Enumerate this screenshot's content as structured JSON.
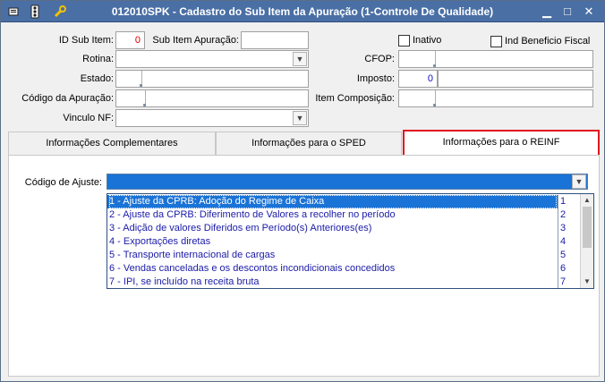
{
  "window": {
    "title": "012010SPK - Cadastro do Sub Item da Apuração (1-Controle De Qualidade)",
    "min_glyph": "▁",
    "max_glyph": "□",
    "close_glyph": "✕"
  },
  "form": {
    "id_sub_item": {
      "label": "ID Sub Item:",
      "value": "0"
    },
    "sub_item_apuracao": {
      "label": "Sub Item Apuração:",
      "value": ""
    },
    "inativo": {
      "label": "Inativo",
      "checked": false
    },
    "ind_beneficio_fiscal": {
      "label": "Ind Beneficio Fiscal",
      "checked": false
    },
    "rotina": {
      "label": "Rotina:",
      "value": ""
    },
    "cfop": {
      "label": "CFOP:",
      "value": ""
    },
    "estado": {
      "label": "Estado:",
      "value": ""
    },
    "imposto": {
      "label": "Imposto:",
      "value": "0"
    },
    "codigo_apuracao": {
      "label": "Código da Apuração:",
      "value": ""
    },
    "item_composicao": {
      "label": "Item Composição:",
      "value": ""
    },
    "vinculo_nf": {
      "label": "Vinculo NF:",
      "value": ""
    }
  },
  "tabs": [
    {
      "label": "Informações Complementares",
      "active": false
    },
    {
      "label": "Informações para o SPED",
      "active": false
    },
    {
      "label": "Informações para o REINF",
      "active": true
    }
  ],
  "reinf": {
    "codigo_ajuste_label": "Código de Ajuste:",
    "codigo_ajuste_value": "",
    "options": [
      {
        "text": "1 - Ajuste da CPRB: Adoção do Regime de Caixa",
        "code": "1",
        "selected": true
      },
      {
        "text": "2 - Ajuste da CPRB: Diferimento de Valores a recolher no período",
        "code": "2",
        "selected": false
      },
      {
        "text": "3 - Adição de valores Diferidos em Período(s) Anteriores(es)",
        "code": "3",
        "selected": false
      },
      {
        "text": "4 - Exportações diretas",
        "code": "4",
        "selected": false
      },
      {
        "text": "5 - Transporte internacional de cargas",
        "code": "5",
        "selected": false
      },
      {
        "text": "6 - Vendas canceladas e os descontos incondicionais concedidos",
        "code": "6",
        "selected": false
      },
      {
        "text": "7 - IPI, se incluído na receita bruta",
        "code": "7",
        "selected": false
      }
    ]
  },
  "colors": {
    "titlebar": "#4a6fa5",
    "selection": "#1a73d6",
    "active_tab_border": "#e0161e",
    "list_text": "#1a1aa8"
  }
}
